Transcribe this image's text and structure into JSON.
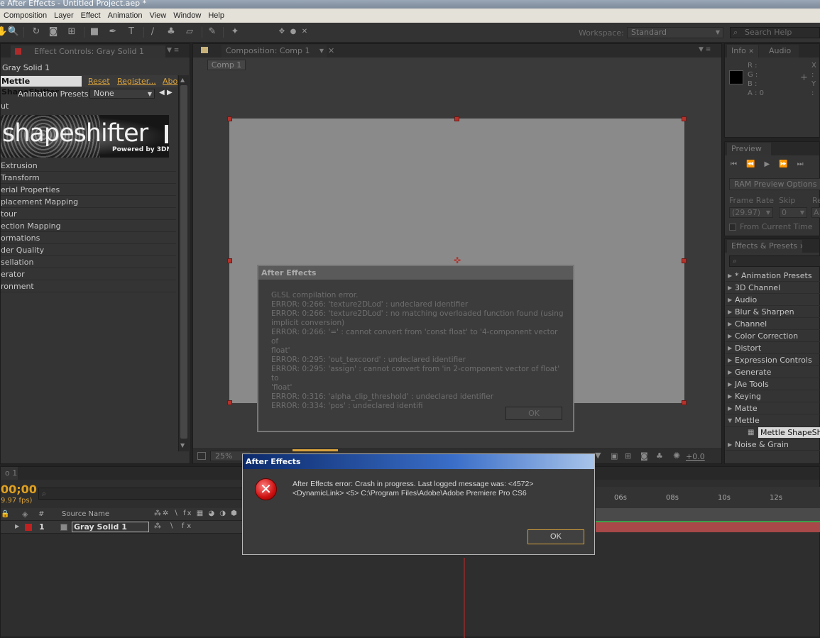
{
  "app": {
    "title": "e After Effects - Untitled Project.aep *"
  },
  "menu": [
    "Composition",
    "Layer",
    "Effect",
    "Animation",
    "View",
    "Window",
    "Help"
  ],
  "toolbar": {
    "workspace_label": "Workspace:",
    "workspace_value": "Standard",
    "search_placeholder": "Search Help"
  },
  "effect_controls": {
    "tab_label": "Effect Controls: Gray Solid 1",
    "layer_name": "Gray Solid 1",
    "effect_name": "Mettle ShapeShifter",
    "reset": "Reset",
    "register": "Register...",
    "about": "Abo",
    "presets_label": "Animation Presets:",
    "presets_value": "None",
    "input_label": "ut",
    "banner_text": "shapeshifter",
    "banner_sub": "Powered by 3DNAE",
    "groups": [
      "Extrusion",
      "Transform",
      "erial Properties",
      "placement Mapping",
      "tour",
      "ection Mapping",
      "ormations",
      "der Quality",
      "sellation",
      "erator",
      "ronment"
    ]
  },
  "composition": {
    "tab_label": "Composition: Comp 1",
    "breadcrumb": "Comp 1",
    "zoom": "25%",
    "exposure": "+0.0"
  },
  "info": {
    "tab_info": "Info",
    "tab_audio": "Audio",
    "r": "R :",
    "g": "G :",
    "b": "B :",
    "a": "A : 0",
    "x": "X :",
    "y": "Y :"
  },
  "preview": {
    "tab": "Preview",
    "ram_options": "RAM Preview Options",
    "frame_rate_label": "Frame Rate",
    "skip_label": "Skip",
    "res_label": "Re",
    "frame_rate_value": "(29.97)",
    "skip_value": "0",
    "res_value": "A",
    "from_current": "From Current Time"
  },
  "effects_presets": {
    "tab": "Effects & Presets",
    "items": [
      "* Animation Presets",
      "3D Channel",
      "Audio",
      "Blur & Sharpen",
      "Channel",
      "Color Correction",
      "Distort",
      "Expression Controls",
      "Generate",
      "JAe Tools",
      "Keying",
      "Matte",
      "Mettle"
    ],
    "sub_item": "Mettle ShapeShif",
    "after_item": "Noise & Grain"
  },
  "timeline": {
    "tab": "o 1",
    "timecode": "00;00",
    "fps": "9.97 fps)",
    "col_num": "#",
    "col_source": "Source Name",
    "layer_num": "1",
    "layer_name": "Gray Solid 1",
    "ruler": [
      "06s",
      "08s",
      "10s",
      "12s"
    ]
  },
  "dialog_glsl": {
    "title": "After Effects",
    "lines": [
      "GLSL compilation error.",
      "ERROR: 0:266: 'texture2DLod' : undeclared identifier",
      "ERROR: 0:266: 'texture2DLod' : no matching overloaded function found (using",
      "implicit conversion)",
      "ERROR: 0:266: '=' :  cannot convert from 'const float' to '4-component vector of",
      "float'",
      "ERROR: 0:295: 'out_texcoord' : undeclared identifier",
      "ERROR: 0:295: 'assign' :  cannot convert from 'in 2-component vector of float' to",
      "'float'",
      "ERROR: 0:316: 'alpha_clip_threshold' : undeclared identifier",
      "ERROR: 0:334: 'pos' : undeclared identifi"
    ],
    "ok": "OK"
  },
  "dialog_crash": {
    "title": "After Effects",
    "line1": "After Effects error: Crash in progress. Last logged message was: <4572>",
    "line2": "<DynamicLink> <5> C:\\Program Files\\Adobe\\Adobe Premiere Pro CS6",
    "ok": "OK"
  },
  "colors": {
    "accent_orange": "#d9a23c",
    "handle_red": "#b5322b",
    "layer_bar": "#a84848"
  }
}
